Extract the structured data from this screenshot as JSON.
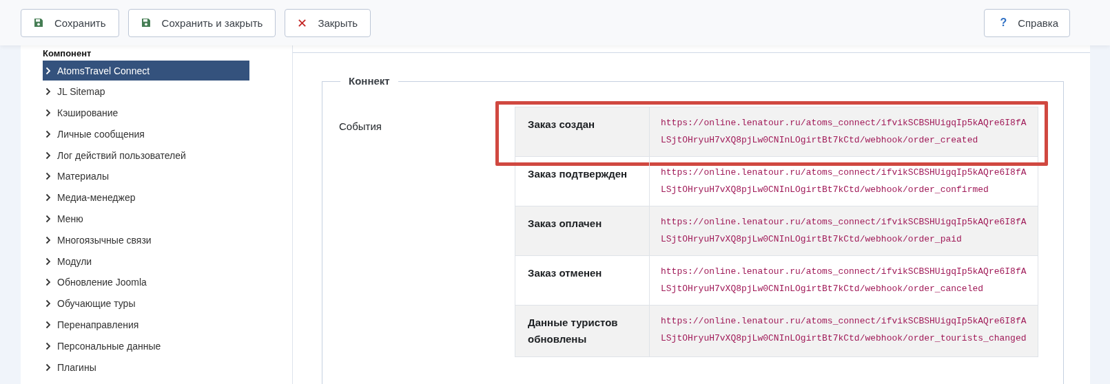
{
  "toolbar": {
    "buttons": [
      {
        "label": "Сохранить",
        "kind": "save"
      },
      {
        "label": "Сохранить и закрыть",
        "kind": "save"
      },
      {
        "label": "Закрыть",
        "kind": "close"
      }
    ],
    "help_button": {
      "icon": "?",
      "label": "Справка"
    }
  },
  "sidebar": {
    "heading": "Компонент",
    "items": [
      {
        "label": "AtomsTravel Connect",
        "selected": true
      },
      {
        "label": "JL Sitemap",
        "selected": false
      },
      {
        "label": "Кэширование",
        "selected": false
      },
      {
        "label": "Личные сообщения",
        "selected": false
      },
      {
        "label": "Лог действий пользователей",
        "selected": false
      },
      {
        "label": "Материалы",
        "selected": false
      },
      {
        "label": "Медиа-менеджер",
        "selected": false
      },
      {
        "label": "Меню",
        "selected": false
      },
      {
        "label": "Многоязычные связи",
        "selected": false
      },
      {
        "label": "Модули",
        "selected": false
      },
      {
        "label": "Обновление Joomla",
        "selected": false
      },
      {
        "label": "Обучающие туры",
        "selected": false
      },
      {
        "label": "Перенаправления",
        "selected": false
      },
      {
        "label": "Персональные данные",
        "selected": false
      },
      {
        "label": "Плагины",
        "selected": false
      }
    ]
  },
  "fieldset": {
    "legend": "Коннект",
    "label": "События",
    "rows": [
      {
        "event": "Заказ создан",
        "url": "https://online.lenatour.ru/atoms_connect/ifvikSCBSHUigqIp5kAQre6I8fALSjtOHryuH7vXQ8pjLw0CNInLOgirtBt7kCtd/webhook/order_created",
        "highlighted": true
      },
      {
        "event": "Заказ подтвержден",
        "url": "https://online.lenatour.ru/atoms_connect/ifvikSCBSHUigqIp5kAQre6I8fALSjtOHryuH7vXQ8pjLw0CNInLOgirtBt7kCtd/webhook/order_confirmed",
        "highlighted": false
      },
      {
        "event": "Заказ оплачен",
        "url": "https://online.lenatour.ru/atoms_connect/ifvikSCBSHUigqIp5kAQre6I8fALSjtOHryuH7vXQ8pjLw0CNInLOgirtBt7kCtd/webhook/order_paid",
        "highlighted": false
      },
      {
        "event": "Заказ отменен",
        "url": "https://online.lenatour.ru/atoms_connect/ifvikSCBSHUigqIp5kAQre6I8fALSjtOHryuH7vXQ8pjLw0CNInLOgirtBt7kCtd/webhook/order_canceled",
        "highlighted": false
      },
      {
        "event": "Данные туристов обновлены",
        "url": "https://online.lenatour.ru/atoms_connect/ifvikSCBSHUigqIp5kAQre6I8fALSjtOHryuH7vXQ8pjLw0CNInLOgirtBt7kCtd/webhook/order_tourists_changed",
        "highlighted": false
      }
    ]
  }
}
